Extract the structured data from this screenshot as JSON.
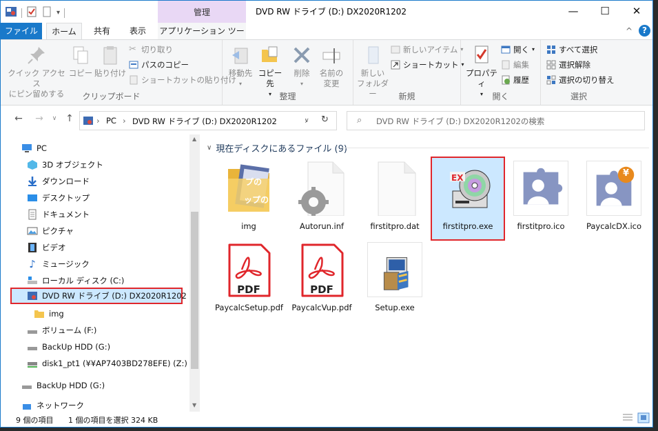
{
  "titlebar": {
    "manage_label": "管理",
    "title": "DVD RW ドライブ (D:) DX2020R1202",
    "minimize": "—",
    "maximize": "☐",
    "close": "✕"
  },
  "tabs": {
    "file": "ファイル",
    "home": "ホーム",
    "share": "共有",
    "view": "表示",
    "app_tools": "アプリケーション ツール",
    "collapse": "^",
    "help": "?"
  },
  "ribbon": {
    "clipboard": {
      "pin": "クイック アクセス\nにピン留めする",
      "copy": "コピー",
      "paste": "貼り付け",
      "cut": "切り取り",
      "copy_path": "パスのコピー",
      "paste_shortcut": "ショートカットの貼り付け",
      "label": "クリップボード"
    },
    "organize": {
      "move_to": "移動先",
      "copy_to": "コピー先",
      "delete": "削除",
      "rename": "名前の\n変更",
      "label": "整理"
    },
    "new": {
      "new_folder": "新しい\nフォルダー",
      "new_item": "新しいアイテム",
      "shortcut": "ショートカット",
      "label": "新規"
    },
    "open": {
      "properties": "プロパティ",
      "open": "開く",
      "edit": "編集",
      "history": "履歴",
      "label": "開く"
    },
    "select": {
      "select_all": "すべて選択",
      "select_none": "選択解除",
      "invert": "選択の切り替え",
      "label": "選択"
    }
  },
  "address": {
    "pc": "PC",
    "drive": "DVD RW ドライブ (D:) DX2020R1202",
    "search_placeholder": "DVD RW ドライブ (D:) DX2020R1202の検索"
  },
  "navpane": {
    "items": [
      {
        "label": "PC"
      },
      {
        "label": "3D オブジェクト"
      },
      {
        "label": "ダウンロード"
      },
      {
        "label": "デスクトップ"
      },
      {
        "label": "ドキュメント"
      },
      {
        "label": "ピクチャ"
      },
      {
        "label": "ビデオ"
      },
      {
        "label": "ミュージック"
      },
      {
        "label": "ローカル ディスク (C:)"
      },
      {
        "label": "DVD RW ドライブ (D:) DX2020R1202"
      },
      {
        "label": "img"
      },
      {
        "label": "ボリューム (F:)"
      },
      {
        "label": "BackUp HDD (G:)"
      },
      {
        "label": "disk1_pt1 (¥¥AP7403BD278EFE) (Z:)"
      },
      {
        "label": "BackUp HDD (G:)"
      },
      {
        "label": "ネットワーク"
      }
    ]
  },
  "content": {
    "group_header": "現在ディスクにあるファイル (9)",
    "files": [
      {
        "name": "img",
        "icon": "folder-icon"
      },
      {
        "name": "Autorun.inf",
        "icon": "settings-file-icon"
      },
      {
        "name": "firstitpro.dat",
        "icon": "blank-file-icon"
      },
      {
        "name": "firstitpro.exe",
        "icon": "cd-exe-icon"
      },
      {
        "name": "firstitpro.ico",
        "icon": "puzzle-user-icon"
      },
      {
        "name": "PaycalcDX.ico",
        "icon": "puzzle-yen-icon"
      },
      {
        "name": "PaycalcSetup.pdf",
        "icon": "pdf-icon"
      },
      {
        "name": "PaycalcVup.pdf",
        "icon": "pdf-icon"
      },
      {
        "name": "Setup.exe",
        "icon": "setup-icon"
      }
    ],
    "pdf_badge": "PDF",
    "ex_badge": "EX",
    "yen_badge": "¥",
    "folder_art_text": "プの",
    "folder_art_text2": "ップの"
  },
  "status": {
    "count": "9 個の項目",
    "selection": "1 個の項目を選択  324 KB"
  },
  "colors": {
    "accent": "#1979ca",
    "selection_bg": "#cce8ff",
    "highlight_red": "#e0262b",
    "manage_tab": "#e9d8f5"
  }
}
